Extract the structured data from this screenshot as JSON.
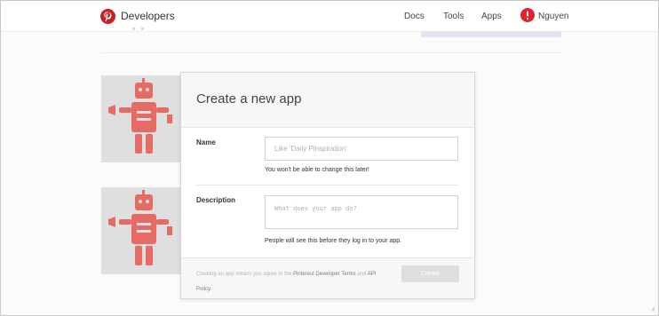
{
  "header": {
    "brand": "Developers",
    "nav": {
      "docs": "Docs",
      "tools": "Tools",
      "apps": "Apps"
    },
    "user": {
      "name": "Nguyen"
    },
    "logo_icon": "pinterest-logo-icon",
    "avatar_icon": "pinterest-avatar-icon"
  },
  "background": {
    "thumbnail_icon": "robot-icon",
    "accent_colors": {
      "brand_red": "#cb2027",
      "robot_red": "#e8574f",
      "panel_lavender": "#e3e4f1"
    }
  },
  "modal": {
    "title": "Create a new app",
    "name_field": {
      "label": "Name",
      "placeholder": "Like 'Daily Pinspiration'",
      "helper": "You won't be able to change this later!"
    },
    "description_field": {
      "label": "Description",
      "placeholder": "What does your app do?",
      "helper": "People will see this before they log in to your app."
    },
    "footer": {
      "terms_prefix": "Creating an app means you agree to the",
      "terms_link": "Pinterest Developer Terms",
      "terms_middle": "and",
      "policy_link": "API Policy",
      "terms_suffix": ".",
      "create_label": "Create"
    }
  }
}
